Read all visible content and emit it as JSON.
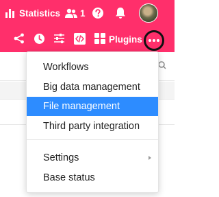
{
  "header": {
    "statistics_label": "Statistics",
    "users_count": "1",
    "plugins_label": "Plugins"
  },
  "icons": {
    "statistics": "bar-chart-icon",
    "users": "users-icon",
    "help": "help-icon",
    "notifications": "bell-icon",
    "share": "share-icon",
    "history": "history-icon",
    "settings": "sliders-icon",
    "code": "code-icon",
    "plugins": "plugins-grid-icon",
    "more": "more-dots-icon"
  },
  "colors": {
    "header_bg": "#ff2f6b",
    "menu_highlight": "#2d8cff"
  },
  "menu": {
    "items": [
      {
        "label": "Workflows"
      },
      {
        "label": "Big data management"
      },
      {
        "label": "File management",
        "active": true
      },
      {
        "label": "Third party integration"
      },
      {
        "label": "Settings",
        "has_submenu": true
      },
      {
        "label": "Base status"
      }
    ]
  }
}
